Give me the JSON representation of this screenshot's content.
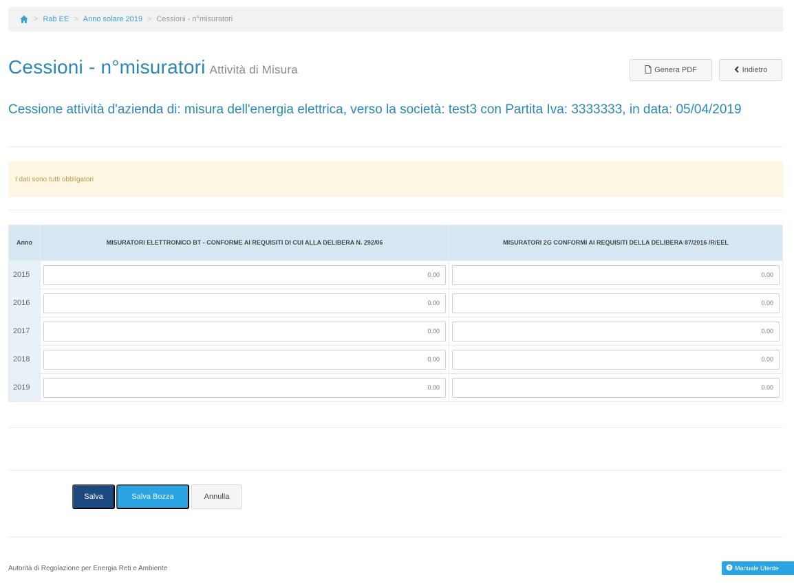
{
  "breadcrumb": {
    "home_icon": "home-icon",
    "items": [
      "Rab EE",
      "Anno solare 2019",
      "Cessioni - n°misuratori"
    ]
  },
  "header": {
    "title": "Cessioni - n°misuratori",
    "subtitle_small": "Attività di Misura",
    "pdf_button": "Genera PDF",
    "back_button": "Indietro"
  },
  "description": "Cessione attività d'azienda di: misura dell'energia elettrica, verso la società: test3 con Partita Iva: 3333333, in data: 05/04/2019",
  "alert": "I dati sono tutti obbligatori",
  "table": {
    "headers": [
      "Anno",
      "MISURATORI ELETTRONICO BT - CONFORME AI REQUISITI DI CUI ALLA DELIBERA N. 292/06",
      "MISURATORI 2G CONFORMI AI REQUISITI DELLA DELIBERA 87/2016 /R/EEL"
    ],
    "rows": [
      {
        "year": "2015",
        "a": "0.00",
        "b": "0.00"
      },
      {
        "year": "2016",
        "a": "0.00",
        "b": "0.00"
      },
      {
        "year": "2017",
        "a": "0.00",
        "b": "0.00"
      },
      {
        "year": "2018",
        "a": "0.00",
        "b": "0.00"
      },
      {
        "year": "2019",
        "a": "0.00",
        "b": "0.00"
      }
    ]
  },
  "actions": {
    "save": "Salva",
    "save_draft": "Salva Bozza",
    "cancel": "Annulla"
  },
  "footer": {
    "org": "Autorità di Regolazione per Energia Reti e Ambiente",
    "manual": "Manuale Utente"
  },
  "colors": {
    "accent": "#2a88b8",
    "primary_button": "#1c4a80",
    "info_button": "#2aa4e3",
    "alert_bg": "#fcf6e2"
  }
}
